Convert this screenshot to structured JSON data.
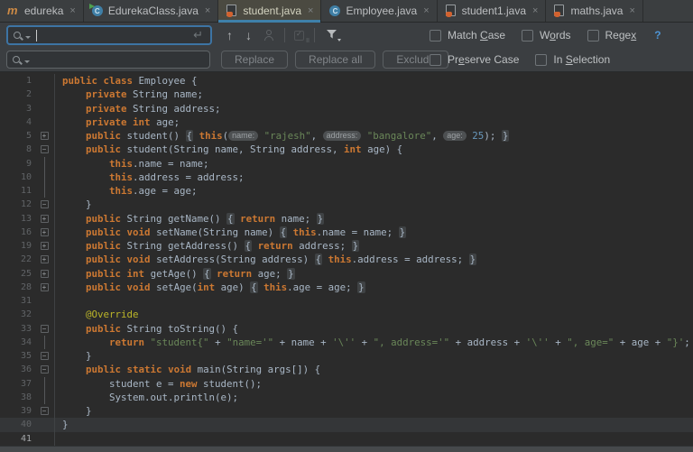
{
  "tabs": [
    {
      "label": "edureka",
      "icon": "maven-icon",
      "active": false,
      "close": "×"
    },
    {
      "label": "EdurekaClass.java",
      "icon": "class-run-icon",
      "active": false,
      "close": "×"
    },
    {
      "label": "student.java",
      "icon": "java-file-icon",
      "active": true,
      "close": "×"
    },
    {
      "label": "Employee.java",
      "icon": "class-icon",
      "active": false,
      "close": "×"
    },
    {
      "label": "student1.java",
      "icon": "java-file-icon",
      "active": false,
      "close": "×"
    },
    {
      "label": "maths.java",
      "icon": "java-file-icon",
      "active": false,
      "close": "×"
    }
  ],
  "find": {
    "query": "",
    "enter_icon": "↵",
    "prev_icon": "↑",
    "next_icon": "↓",
    "options": [
      {
        "label": "Match Case",
        "mnemonic": "C"
      },
      {
        "label": "Words",
        "mnemonic": "o"
      },
      {
        "label": "Regex",
        "mnemonic": "x"
      }
    ],
    "help": "?"
  },
  "replace": {
    "query": "",
    "buttons": [
      "Replace",
      "Replace all",
      "Exclude"
    ],
    "options": [
      {
        "label": "Preserve Case",
        "mnemonic": "e"
      },
      {
        "label": "In Selection",
        "mnemonic": "S"
      }
    ]
  },
  "colors": {
    "keyword": "#cc7832",
    "string": "#6a8759",
    "number": "#6897bb",
    "annotation": "#bbb529",
    "plain": "#a9b7c6",
    "line_number": "#606366",
    "editor_bg": "#2b2b2b",
    "panel_bg": "#3b3e41",
    "tab_underline": "#3e80aa",
    "focus_border": "#3d74a4",
    "help_blue": "#4e94d4"
  },
  "editor": {
    "lines": [
      {
        "n": 1,
        "f": null,
        "fl": false,
        "hl": false,
        "br": false,
        "seg": [
          [
            "k",
            "public"
          ],
          [
            "p",
            " "
          ],
          [
            "k",
            "class"
          ],
          [
            "p",
            " Employee {"
          ]
        ]
      },
      {
        "n": 2,
        "f": null,
        "fl": false,
        "hl": false,
        "br": false,
        "seg": [
          [
            "p",
            "    "
          ],
          [
            "k",
            "private"
          ],
          [
            "p",
            " String name;"
          ]
        ]
      },
      {
        "n": 3,
        "f": null,
        "fl": false,
        "hl": false,
        "br": false,
        "seg": [
          [
            "p",
            "    "
          ],
          [
            "k",
            "private"
          ],
          [
            "p",
            " String address;"
          ]
        ]
      },
      {
        "n": 4,
        "f": null,
        "fl": false,
        "hl": false,
        "br": false,
        "seg": [
          [
            "p",
            "    "
          ],
          [
            "k",
            "private"
          ],
          [
            "p",
            " "
          ],
          [
            "k",
            "int"
          ],
          [
            "p",
            " age;"
          ]
        ]
      },
      {
        "n": 5,
        "f": "+",
        "fl": false,
        "hl": false,
        "br": false,
        "seg": [
          [
            "p",
            "    "
          ],
          [
            "k",
            "public"
          ],
          [
            "p",
            " student() "
          ],
          [
            "fb",
            "{"
          ],
          [
            "p",
            " "
          ],
          [
            "k",
            "this"
          ],
          [
            "p",
            "("
          ],
          [
            "h",
            "name:"
          ],
          [
            "p",
            " "
          ],
          [
            "s",
            "\"rajesh\""
          ],
          [
            "p",
            ", "
          ],
          [
            "h",
            "address:"
          ],
          [
            "p",
            " "
          ],
          [
            "s",
            "\"bangalore\""
          ],
          [
            "p",
            ", "
          ],
          [
            "h",
            "age:"
          ],
          [
            "p",
            " "
          ],
          [
            "n",
            "25"
          ],
          [
            "p",
            "); "
          ],
          [
            "fb",
            "}"
          ]
        ]
      },
      {
        "n": 8,
        "f": "-",
        "fl": false,
        "hl": false,
        "br": false,
        "seg": [
          [
            "p",
            "    "
          ],
          [
            "k",
            "public"
          ],
          [
            "p",
            " student(String name, String address, "
          ],
          [
            "k",
            "int"
          ],
          [
            "p",
            " age) {"
          ]
        ]
      },
      {
        "n": 9,
        "f": null,
        "fl": true,
        "hl": false,
        "br": false,
        "seg": [
          [
            "p",
            "        "
          ],
          [
            "k",
            "this"
          ],
          [
            "p",
            ".name = name;"
          ]
        ]
      },
      {
        "n": 10,
        "f": null,
        "fl": true,
        "hl": false,
        "br": false,
        "seg": [
          [
            "p",
            "        "
          ],
          [
            "k",
            "this"
          ],
          [
            "p",
            ".address = address;"
          ]
        ]
      },
      {
        "n": 11,
        "f": null,
        "fl": true,
        "hl": false,
        "br": false,
        "seg": [
          [
            "p",
            "        "
          ],
          [
            "k",
            "this"
          ],
          [
            "p",
            ".age = age;"
          ]
        ]
      },
      {
        "n": 12,
        "f": "e",
        "fl": false,
        "hl": false,
        "br": false,
        "seg": [
          [
            "p",
            "    }"
          ]
        ]
      },
      {
        "n": 13,
        "f": "+",
        "fl": false,
        "hl": false,
        "br": false,
        "seg": [
          [
            "p",
            "    "
          ],
          [
            "k",
            "public"
          ],
          [
            "p",
            " String getName() "
          ],
          [
            "fb",
            "{"
          ],
          [
            "p",
            " "
          ],
          [
            "k",
            "return"
          ],
          [
            "p",
            " name; "
          ],
          [
            "fb",
            "}"
          ]
        ]
      },
      {
        "n": 16,
        "f": "+",
        "fl": false,
        "hl": false,
        "br": false,
        "seg": [
          [
            "p",
            "    "
          ],
          [
            "k",
            "public"
          ],
          [
            "p",
            " "
          ],
          [
            "k",
            "void"
          ],
          [
            "p",
            " setName(String name) "
          ],
          [
            "fb",
            "{"
          ],
          [
            "p",
            " "
          ],
          [
            "k",
            "this"
          ],
          [
            "p",
            ".name = name; "
          ],
          [
            "fb",
            "}"
          ]
        ]
      },
      {
        "n": 19,
        "f": "+",
        "fl": false,
        "hl": false,
        "br": false,
        "seg": [
          [
            "p",
            "    "
          ],
          [
            "k",
            "public"
          ],
          [
            "p",
            " String getAddress() "
          ],
          [
            "fb",
            "{"
          ],
          [
            "p",
            " "
          ],
          [
            "k",
            "return"
          ],
          [
            "p",
            " address; "
          ],
          [
            "fb",
            "}"
          ]
        ]
      },
      {
        "n": 22,
        "f": "+",
        "fl": false,
        "hl": false,
        "br": false,
        "seg": [
          [
            "p",
            "    "
          ],
          [
            "k",
            "public"
          ],
          [
            "p",
            " "
          ],
          [
            "k",
            "void"
          ],
          [
            "p",
            " setAddress(String address) "
          ],
          [
            "fb",
            "{"
          ],
          [
            "p",
            " "
          ],
          [
            "k",
            "this"
          ],
          [
            "p",
            ".address = address; "
          ],
          [
            "fb",
            "}"
          ]
        ]
      },
      {
        "n": 25,
        "f": "+",
        "fl": false,
        "hl": false,
        "br": false,
        "seg": [
          [
            "p",
            "    "
          ],
          [
            "k",
            "public"
          ],
          [
            "p",
            " "
          ],
          [
            "k",
            "int"
          ],
          [
            "p",
            " getAge() "
          ],
          [
            "fb",
            "{"
          ],
          [
            "p",
            " "
          ],
          [
            "k",
            "return"
          ],
          [
            "p",
            " age; "
          ],
          [
            "fb",
            "}"
          ]
        ]
      },
      {
        "n": 28,
        "f": "+",
        "fl": false,
        "hl": false,
        "br": false,
        "seg": [
          [
            "p",
            "    "
          ],
          [
            "k",
            "public"
          ],
          [
            "p",
            " "
          ],
          [
            "k",
            "void"
          ],
          [
            "p",
            " setAge("
          ],
          [
            "k",
            "int"
          ],
          [
            "p",
            " age) "
          ],
          [
            "fb",
            "{"
          ],
          [
            "p",
            " "
          ],
          [
            "k",
            "this"
          ],
          [
            "p",
            ".age = age; "
          ],
          [
            "fb",
            "}"
          ]
        ]
      },
      {
        "n": 31,
        "f": null,
        "fl": false,
        "hl": false,
        "br": false,
        "seg": []
      },
      {
        "n": 32,
        "f": null,
        "fl": false,
        "hl": false,
        "br": false,
        "seg": [
          [
            "p",
            "    "
          ],
          [
            "a",
            "@Override"
          ]
        ]
      },
      {
        "n": 33,
        "f": "-",
        "fl": false,
        "hl": false,
        "br": false,
        "seg": [
          [
            "p",
            "    "
          ],
          [
            "k",
            "public"
          ],
          [
            "p",
            " String toString() {"
          ]
        ]
      },
      {
        "n": 34,
        "f": null,
        "fl": true,
        "hl": false,
        "br": false,
        "seg": [
          [
            "p",
            "        "
          ],
          [
            "k",
            "return"
          ],
          [
            "p",
            " "
          ],
          [
            "s",
            "\"student{\""
          ],
          [
            "p",
            " + "
          ],
          [
            "s",
            "\"name='\""
          ],
          [
            "p",
            " + name + "
          ],
          [
            "s",
            "'\\''"
          ],
          [
            "p",
            " + "
          ],
          [
            "s",
            "\", address='\""
          ],
          [
            "p",
            " + address + "
          ],
          [
            "s",
            "'\\''"
          ],
          [
            "p",
            " + "
          ],
          [
            "s",
            "\", age=\""
          ],
          [
            "p",
            " + age + "
          ],
          [
            "s",
            "\"}'"
          ],
          [
            "p",
            ";"
          ]
        ]
      },
      {
        "n": 35,
        "f": "e",
        "fl": false,
        "hl": false,
        "br": false,
        "seg": [
          [
            "p",
            "    }"
          ]
        ]
      },
      {
        "n": 36,
        "f": "-",
        "fl": false,
        "hl": false,
        "br": false,
        "seg": [
          [
            "p",
            "    "
          ],
          [
            "k",
            "public"
          ],
          [
            "p",
            " "
          ],
          [
            "k",
            "static"
          ],
          [
            "p",
            " "
          ],
          [
            "k",
            "void"
          ],
          [
            "p",
            " main(String args[]) {"
          ]
        ]
      },
      {
        "n": 37,
        "f": null,
        "fl": true,
        "hl": false,
        "br": false,
        "seg": [
          [
            "p",
            "        student e = "
          ],
          [
            "k",
            "new"
          ],
          [
            "p",
            " student();"
          ]
        ]
      },
      {
        "n": 38,
        "f": null,
        "fl": true,
        "hl": false,
        "br": false,
        "seg": [
          [
            "p",
            "        System.out.println(e);"
          ]
        ]
      },
      {
        "n": 39,
        "f": "e",
        "fl": false,
        "hl": false,
        "br": false,
        "seg": [
          [
            "p",
            "    }"
          ]
        ]
      },
      {
        "n": 40,
        "f": null,
        "fl": false,
        "hl": true,
        "br": false,
        "seg": [
          [
            "p",
            "}"
          ]
        ]
      },
      {
        "n": 41,
        "f": null,
        "fl": false,
        "hl": false,
        "br": true,
        "seg": []
      }
    ]
  }
}
